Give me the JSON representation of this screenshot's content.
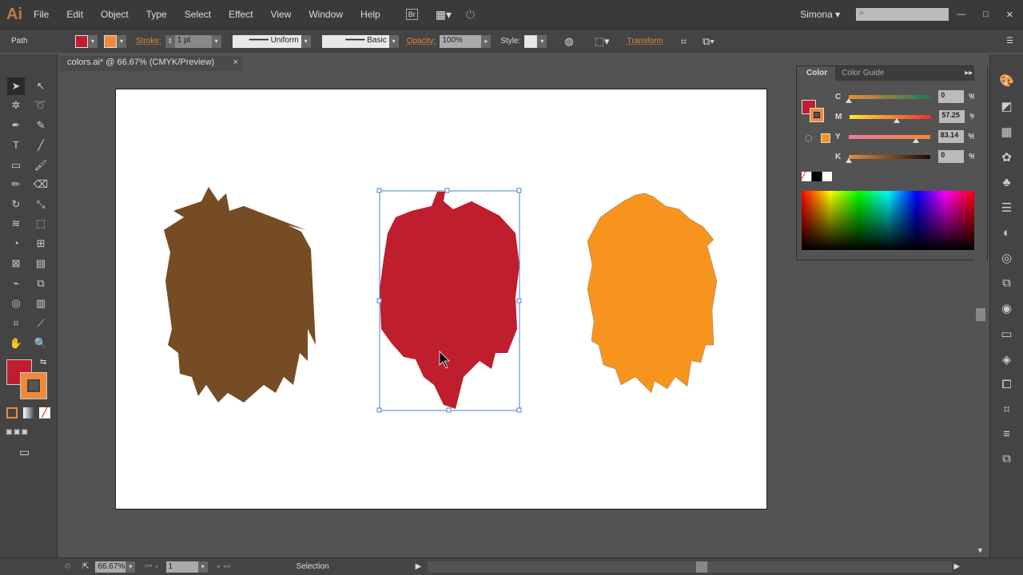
{
  "app": {
    "logo": "Ai",
    "user": "Simona ▾",
    "search_placeholder": ""
  },
  "menu": [
    "File",
    "Edit",
    "Object",
    "Type",
    "Select",
    "Effect",
    "View",
    "Window",
    "Help"
  ],
  "control": {
    "selection_type": "Path",
    "fill_color": "#be1e2d",
    "stroke_color": "#f7941d",
    "stroke_label": "Stroke:",
    "stroke_weight": "1 pt",
    "profile": "Uniform",
    "brush": "Basic",
    "opacity_label": "Opacity:",
    "opacity": "100%",
    "style_label": "Style:",
    "transform_label": "Transform"
  },
  "document": {
    "tab": "colors.ai* @ 66.67% (CMYK/Preview)",
    "close": "×"
  },
  "color_panel": {
    "tabs": [
      "Color",
      "Color Guide"
    ],
    "channels": [
      {
        "label": "C",
        "value": "0",
        "pct": 0,
        "grad": "linear-gradient(to right,#f08a3a,#1d7a5a)"
      },
      {
        "label": "M",
        "value": "57.25",
        "pct": 57.25,
        "grad": "linear-gradient(to right,#ffe62a,#ee2a3a)"
      },
      {
        "label": "Y",
        "value": "83.14",
        "pct": 83.14,
        "grad": "linear-gradient(to right,#ee7aa0,#f08a2a)"
      },
      {
        "label": "K",
        "value": "0",
        "pct": 0,
        "grad": "linear-gradient(to right,#f08a3a,#1a0a00)"
      }
    ],
    "percent": "%"
  },
  "artwork": {
    "colors": [
      "#754c24",
      "#be1e2d",
      "#f7941d"
    ]
  },
  "status": {
    "zoom": "66.67%",
    "artboard": "1",
    "tool": "Selection"
  }
}
